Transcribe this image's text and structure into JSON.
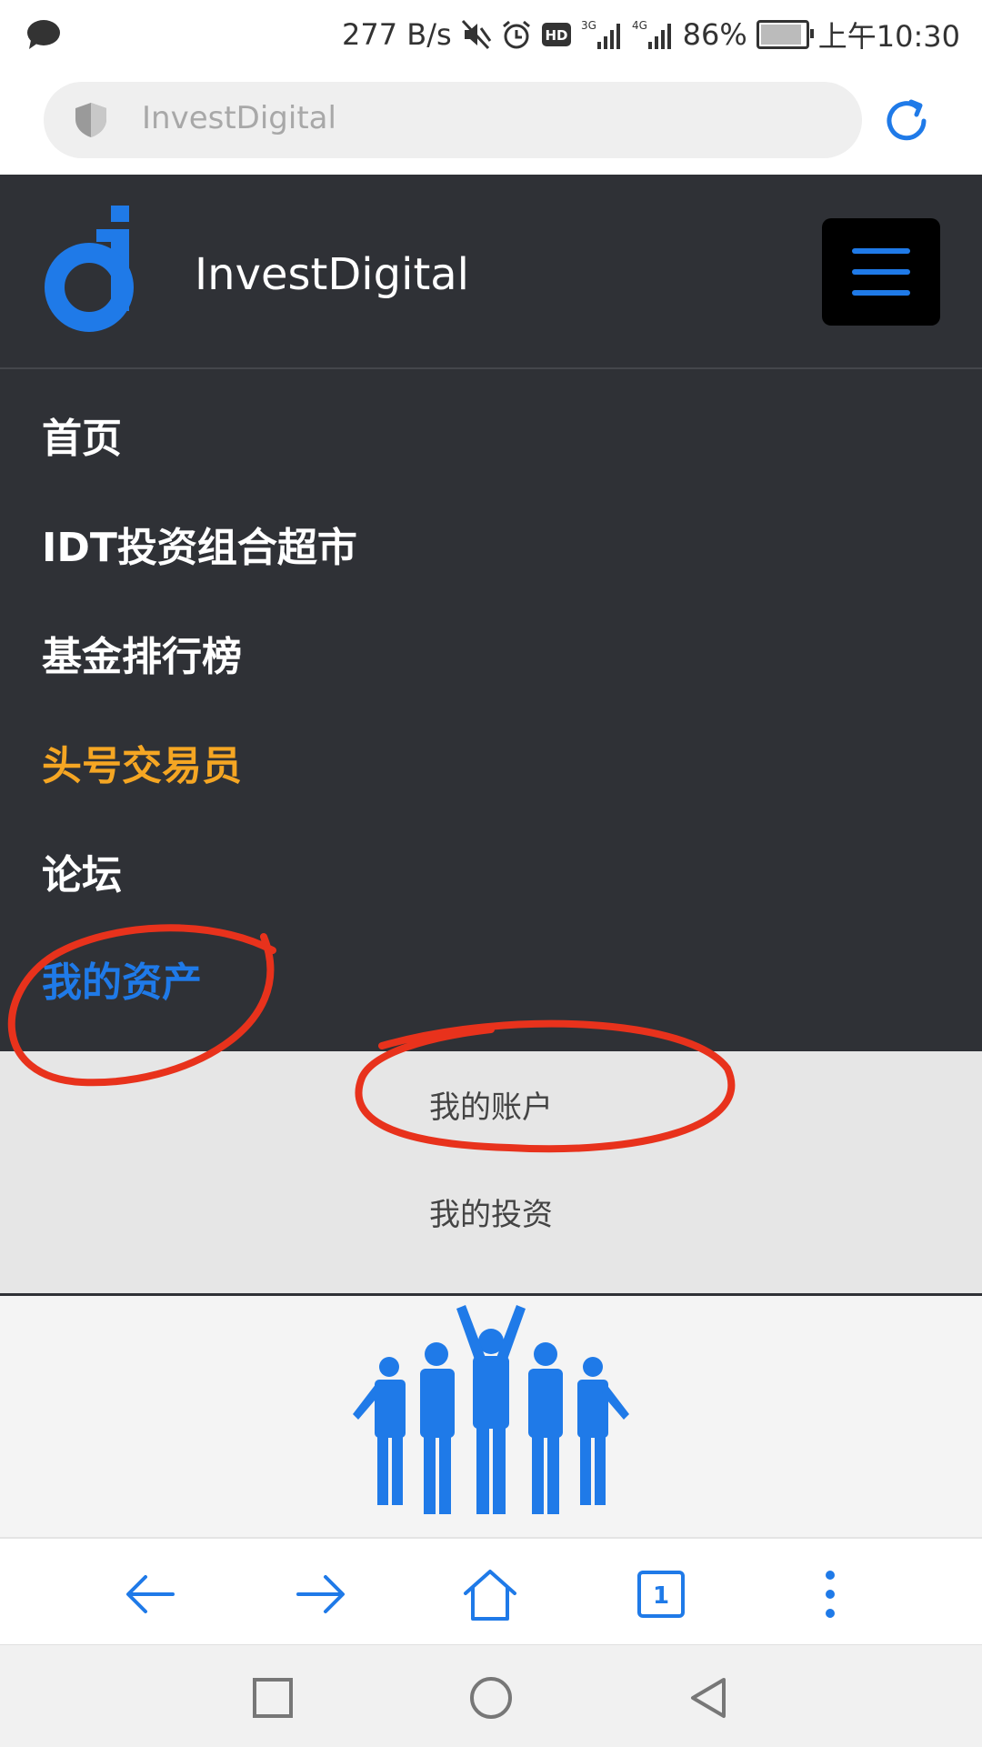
{
  "status_bar": {
    "net_speed": "277 B/s",
    "net_3g": "3G",
    "net_4g": "4G",
    "battery": "86%",
    "time": "上午10:30"
  },
  "address_bar": {
    "url": "InvestDigital"
  },
  "site": {
    "brand_name": "InvestDigital",
    "nav_items": [
      {
        "label": "首页",
        "color": "#ffffff"
      },
      {
        "label": "IDT投资组合超市",
        "color": "#ffffff"
      },
      {
        "label": "基金排行榜",
        "color": "#ffffff"
      },
      {
        "label": "头号交易员",
        "color": "#f5a623"
      },
      {
        "label": "论坛",
        "color": "#ffffff"
      },
      {
        "label": "我的资产",
        "color": "#1f7ae8"
      }
    ],
    "submenu": [
      {
        "label": "我的账户"
      },
      {
        "label": "我的投资"
      }
    ]
  },
  "toolbar": {
    "tab_count": "1"
  },
  "colors": {
    "accent": "#1f7ae8",
    "highlight": "#f5a623",
    "annotation": "#e8321c",
    "dark_bg": "#2f3136"
  }
}
